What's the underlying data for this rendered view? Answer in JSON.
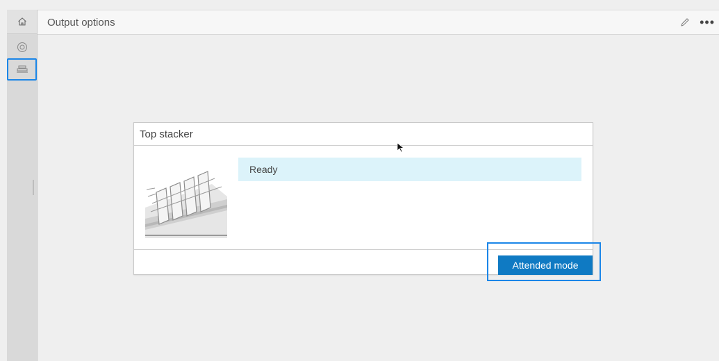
{
  "header": {
    "title": "Output options",
    "more_label": "•••"
  },
  "card": {
    "title": "Top stacker",
    "status": "Ready",
    "button_label": "Attended mode"
  },
  "colors": {
    "accent": "#1b86e8",
    "primary_button": "#0f7ac3",
    "status_bg": "#dcf3fa"
  },
  "icons": [
    "home-icon",
    "settings-icon",
    "output-tray-icon",
    "edit-pen-icon",
    "more-options-icon"
  ]
}
